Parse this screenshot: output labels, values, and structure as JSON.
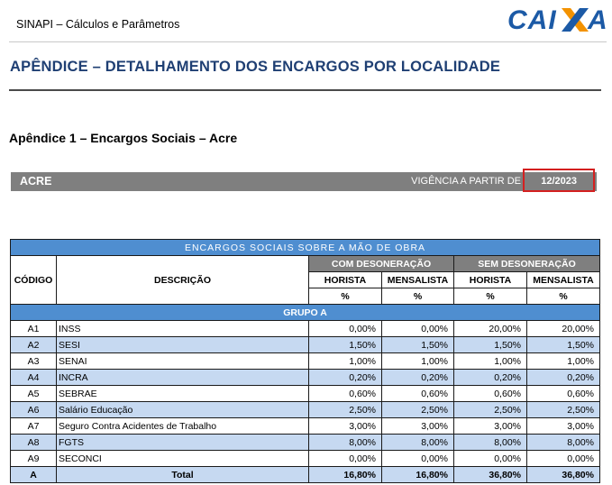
{
  "header": {
    "title": "SINAPI – Cálculos e Parâmetros",
    "logo_text": "CAIXA"
  },
  "section_title": "APÊNDICE – DETALHAMENTO DOS ENCARGOS POR LOCALIDADE",
  "subsection_title": "Apêndice 1 – Encargos Sociais – Acre",
  "state_bar": {
    "state": "ACRE",
    "vigencia_label": "VIGÊNCIA A PARTIR DE",
    "vigencia_date": "12/2023"
  },
  "table": {
    "title": "ENCARGOS SOCIAIS SOBRE A MÃO DE OBRA",
    "col_codigo": "CÓDIGO",
    "col_descricao": "DESCRIÇÃO",
    "com_desoneracao": "COM DESONERAÇÃO",
    "sem_desoneracao": "SEM DESONERAÇÃO",
    "horista": "HORISTA",
    "mensalista": "MENSALISTA",
    "pct": "%",
    "group": "GRUPO A",
    "rows": [
      {
        "code": "A1",
        "desc": "INSS",
        "com_h": "0,00%",
        "com_m": "0,00%",
        "sem_h": "20,00%",
        "sem_m": "20,00%"
      },
      {
        "code": "A2",
        "desc": "SESI",
        "com_h": "1,50%",
        "com_m": "1,50%",
        "sem_h": "1,50%",
        "sem_m": "1,50%"
      },
      {
        "code": "A3",
        "desc": "SENAI",
        "com_h": "1,00%",
        "com_m": "1,00%",
        "sem_h": "1,00%",
        "sem_m": "1,00%"
      },
      {
        "code": "A4",
        "desc": "INCRA",
        "com_h": "0,20%",
        "com_m": "0,20%",
        "sem_h": "0,20%",
        "sem_m": "0,20%"
      },
      {
        "code": "A5",
        "desc": "SEBRAE",
        "com_h": "0,60%",
        "com_m": "0,60%",
        "sem_h": "0,60%",
        "sem_m": "0,60%"
      },
      {
        "code": "A6",
        "desc": "Salário Educação",
        "com_h": "2,50%",
        "com_m": "2,50%",
        "sem_h": "2,50%",
        "sem_m": "2,50%"
      },
      {
        "code": "A7",
        "desc": "Seguro Contra Acidentes de Trabalho",
        "com_h": "3,00%",
        "com_m": "3,00%",
        "sem_h": "3,00%",
        "sem_m": "3,00%"
      },
      {
        "code": "A8",
        "desc": "FGTS",
        "com_h": "8,00%",
        "com_m": "8,00%",
        "sem_h": "8,00%",
        "sem_m": "8,00%"
      },
      {
        "code": "A9",
        "desc": "SECONCI",
        "com_h": "0,00%",
        "com_m": "0,00%",
        "sem_h": "0,00%",
        "sem_m": "0,00%"
      }
    ],
    "total": {
      "code": "A",
      "desc": "Total",
      "com_h": "16,80%",
      "com_m": "16,80%",
      "sem_h": "36,80%",
      "sem_m": "36,80%"
    }
  },
  "colors": {
    "header_blue": "#4f8ed0",
    "row_blue": "#c6d9f1",
    "gray": "#7f7f7f",
    "title_blue": "#1f3f73",
    "highlight_red": "#d42020",
    "logo_blue": "#1c5aa6",
    "logo_orange": "#f39200"
  }
}
